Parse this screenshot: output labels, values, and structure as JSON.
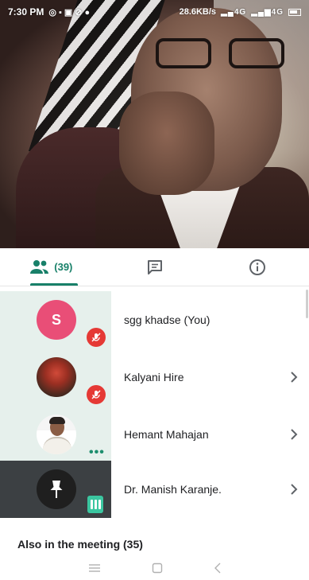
{
  "status_bar": {
    "time": "7:30 PM",
    "network_speed": "28.6KB/s",
    "signal_1": "4G",
    "signal_2": "4G",
    "notification_icons": [
      "whatsapp-icon",
      "chat-icon",
      "gallery-icon",
      "block-icon",
      "location-icon"
    ]
  },
  "tabs": [
    {
      "name": "people",
      "icon": "people-icon",
      "count": "(39)",
      "active": true
    },
    {
      "name": "chat",
      "icon": "chat-bubble-icon",
      "active": false
    },
    {
      "name": "info",
      "icon": "info-icon",
      "active": false
    }
  ],
  "participants": [
    {
      "name": "sgg khadse (You)",
      "avatar": "initial",
      "initial": "S",
      "avatar_color": "#e94e77",
      "state": "muted",
      "has_chevron": false
    },
    {
      "name": "Kalyani Hire",
      "avatar": "photo",
      "state": "muted",
      "has_chevron": true
    },
    {
      "name": "Hemant Mahajan",
      "avatar": "photo",
      "state": "speaking-dots",
      "has_chevron": true
    },
    {
      "name": "Dr. Manish Karanje.",
      "avatar": "pin",
      "state": "audio-level",
      "has_chevron": true
    }
  ],
  "also_in_meeting": "Also in the meeting (35)",
  "colors": {
    "accent": "#188069",
    "mute_red": "#e53935",
    "tile_light": "#e6f0ec",
    "tile_dark": "#3c4043",
    "audio_bar": "#3bc6a0"
  },
  "navbar": [
    "menu-icon",
    "home-square-icon",
    "back-chevron-icon"
  ]
}
